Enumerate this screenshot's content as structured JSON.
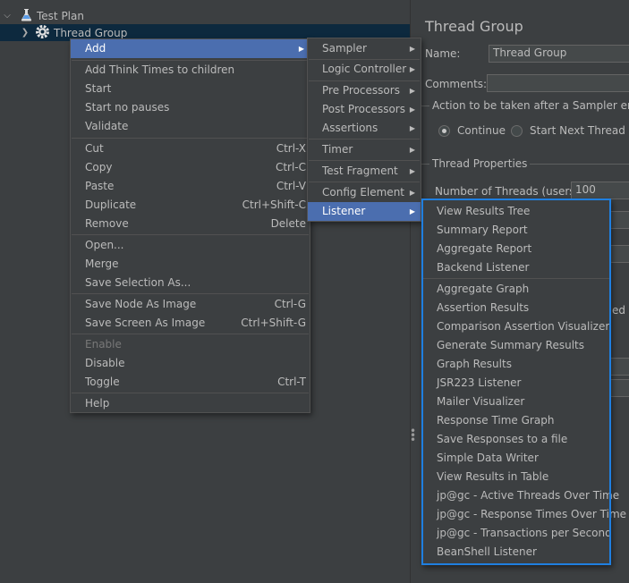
{
  "tree": {
    "test_plan": "Test Plan",
    "thread_group": "Thread Group"
  },
  "panel": {
    "title": "Thread Group",
    "name_label": "Name:",
    "name_value": "Thread Group",
    "comments_label": "Comments:",
    "action_label": "Action to be taken after a Sampler error",
    "continue_label": "Continue",
    "start_next_label": "Start Next Thread Lo",
    "thread_props_label": "Thread Properties",
    "num_threads_label": "Number of Threads (users):",
    "num_threads_value": "100",
    "partial_ed": "ed"
  },
  "context_menu": {
    "add": "Add",
    "add_think_times": "Add Think Times to children",
    "start": "Start",
    "start_no_pauses": "Start no pauses",
    "validate": "Validate",
    "cut": "Cut",
    "cut_key": "Ctrl-X",
    "copy": "Copy",
    "copy_key": "Ctrl-C",
    "paste": "Paste",
    "paste_key": "Ctrl-V",
    "duplicate": "Duplicate",
    "duplicate_key": "Ctrl+Shift-C",
    "remove": "Remove",
    "remove_key": "Delete",
    "open": "Open...",
    "merge": "Merge",
    "save_selection": "Save Selection As...",
    "save_node_image": "Save Node As Image",
    "save_node_image_key": "Ctrl-G",
    "save_screen_image": "Save Screen As Image",
    "save_screen_image_key": "Ctrl+Shift-G",
    "enable": "Enable",
    "disable": "Disable",
    "toggle": "Toggle",
    "toggle_key": "Ctrl-T",
    "help": "Help"
  },
  "add_menu": {
    "sampler": "Sampler",
    "logic_controller": "Logic Controller",
    "pre_processors": "Pre Processors",
    "post_processors": "Post Processors",
    "assertions": "Assertions",
    "timer": "Timer",
    "test_fragment": "Test Fragment",
    "config_element": "Config Element",
    "listener": "Listener"
  },
  "listener_menu": [
    "View Results Tree",
    "Summary Report",
    "Aggregate Report",
    "Backend Listener",
    "Aggregate Graph",
    "Assertion Results",
    "Comparison Assertion Visualizer",
    "Generate Summary Results",
    "Graph Results",
    "JSR223 Listener",
    "Mailer Visualizer",
    "Response Time Graph",
    "Save Responses to a file",
    "Simple Data Writer",
    "View Results in Table",
    "jp@gc - Active Threads Over Time",
    "jp@gc - Response Times Over Time",
    "jp@gc - Transactions per Second",
    "BeanShell Listener"
  ],
  "colors": {
    "background": "#3c3f41",
    "menu_highlight": "#4b6eaf",
    "selection": "#0d293e",
    "outline": "#1f7fe0"
  }
}
